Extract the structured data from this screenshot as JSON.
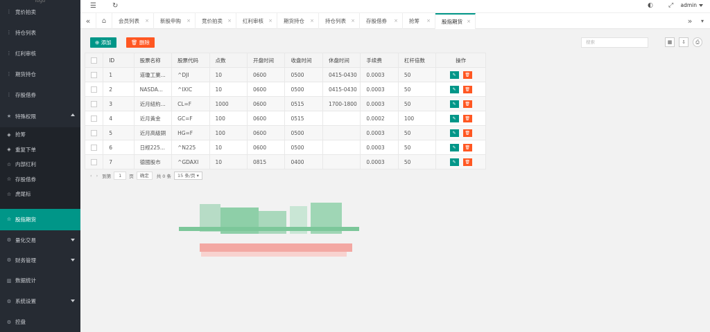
{
  "sidebar": {
    "logo": "logo",
    "top_items": [
      {
        "label": "竞价拍卖",
        "icon": "menu-dots-icon"
      },
      {
        "label": "持仓列表",
        "icon": "menu-dots-icon"
      },
      {
        "label": "红利审核",
        "icon": "menu-dots-icon"
      },
      {
        "label": "期货持仓",
        "icon": "menu-dots-icon"
      },
      {
        "label": "存股借券",
        "icon": "menu-dots-icon"
      }
    ],
    "group_special": {
      "label": "特殊权限",
      "icon": "star-icon",
      "expanded": true
    },
    "sub_items": [
      {
        "label": "抢筹",
        "icon": "diamond-icon"
      },
      {
        "label": "重复下单",
        "icon": "diamond-icon"
      },
      {
        "label": "内部红利",
        "icon": "star-outline-icon"
      },
      {
        "label": "存股借券",
        "icon": "star-outline-icon"
      },
      {
        "label": "虎尾标",
        "icon": "star-outline-icon"
      }
    ],
    "active_item": {
      "label": "股指期货",
      "icon": "star-outline-icon"
    },
    "bottom_items": [
      {
        "label": "量化交易",
        "icon": "gear-icon",
        "expandable": true
      },
      {
        "label": "财务管理",
        "icon": "gear-icon",
        "expandable": true
      },
      {
        "label": "数据统计",
        "icon": "chart-icon",
        "expandable": false
      },
      {
        "label": "系统设置",
        "icon": "gear-icon",
        "expandable": true
      },
      {
        "label": "控盘",
        "icon": "gear-icon",
        "expandable": false
      }
    ]
  },
  "header": {
    "user": "admin"
  },
  "tabs": [
    {
      "label": "会员列表",
      "active": false
    },
    {
      "label": "新股申购",
      "active": false
    },
    {
      "label": "竞价拍卖",
      "active": false
    },
    {
      "label": "红利审核",
      "active": false
    },
    {
      "label": "期货持仓",
      "active": false
    },
    {
      "label": "持仓列表",
      "active": false
    },
    {
      "label": "存股借券",
      "active": false
    },
    {
      "label": "抢筹",
      "active": false
    },
    {
      "label": "股指期货",
      "active": true
    }
  ],
  "toolbar": {
    "add_label": "添加",
    "delete_label": "删除",
    "search_placeholder": "搜索"
  },
  "table": {
    "columns": [
      "ID",
      "股票名称",
      "股票代码",
      "点数",
      "开盘时间",
      "收盘时间",
      "休盘时间",
      "手续费",
      "杠杆倍数",
      "操作"
    ],
    "rows": [
      [
        "1",
        "道瓊工業...",
        "^DJI",
        "10",
        "0600",
        "0500",
        "0415-0430",
        "0.0003",
        "50"
      ],
      [
        "2",
        "NASDA...",
        "^IXIC",
        "10",
        "0600",
        "0500",
        "0415-0430",
        "0.0003",
        "50"
      ],
      [
        "3",
        "近月紐約...",
        "CL=F",
        "1000",
        "0600",
        "0515",
        "1700-1800",
        "0.0003",
        "50"
      ],
      [
        "4",
        "近月黃金",
        "GC=F",
        "100",
        "0600",
        "0515",
        "",
        "0.0002",
        "100"
      ],
      [
        "5",
        "近月高級銅",
        "HG=F",
        "100",
        "0600",
        "0500",
        "",
        "0.0003",
        "50"
      ],
      [
        "6",
        "日經225...",
        "^N225",
        "10",
        "0600",
        "0500",
        "",
        "0.0003",
        "50"
      ],
      [
        "7",
        "德國股市",
        "^GDAXI",
        "10",
        "0815",
        "0400",
        "",
        "0.0003",
        "50"
      ]
    ]
  },
  "pager": {
    "goto_label": "到第",
    "page_value": "1",
    "page_unit": "页",
    "confirm_label": "确定",
    "total_label": "共 0 条",
    "page_size": "15 条/页"
  },
  "colors": {
    "primary": "#009688",
    "danger": "#ff5722",
    "sidebar_bg": "#262b33"
  }
}
